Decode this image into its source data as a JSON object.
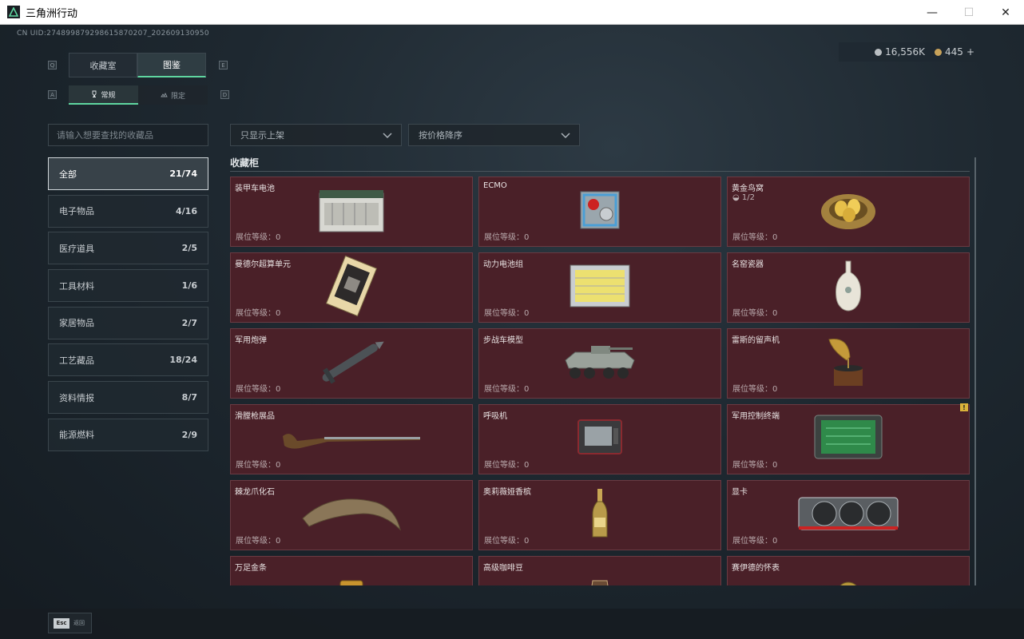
{
  "window": {
    "title": "三角洲行动",
    "minimize": "—",
    "maximize": "☐",
    "close": "✕"
  },
  "uid": "CN UID:274899879298615870207_202609130950",
  "currency": {
    "silver": "16,556K",
    "gold": "445",
    "plus": "+"
  },
  "keys": {
    "tab_left": "Q",
    "tab_right": "E",
    "sub_left": "A",
    "sub_right": "D"
  },
  "tabs": [
    {
      "label": "收藏室",
      "active": false
    },
    {
      "label": "图鉴",
      "active": true
    }
  ],
  "subtabs": [
    {
      "label": "常规",
      "active": true
    },
    {
      "label": "限定",
      "active": false
    }
  ],
  "search": {
    "placeholder": "请输入想要查找的收藏品"
  },
  "filters": {
    "shelf": "只显示上架",
    "sort": "按价格降序"
  },
  "categories": [
    {
      "label": "全部",
      "count": "21/74",
      "active": true
    },
    {
      "label": "电子物品",
      "count": "4/16"
    },
    {
      "label": "医疗道具",
      "count": "2/5"
    },
    {
      "label": "工具材料",
      "count": "1/6"
    },
    {
      "label": "家居物品",
      "count": "2/7"
    },
    {
      "label": "工艺藏品",
      "count": "18/24"
    },
    {
      "label": "资料情报",
      "count": "8/7"
    },
    {
      "label": "能源燃料",
      "count": "2/9"
    }
  ],
  "section_title": "收藏柜",
  "level_label": "展位等级：0",
  "items": [
    {
      "name": "装甲车电池",
      "icon": "battery"
    },
    {
      "name": "ECMO",
      "icon": "ecmo"
    },
    {
      "name": "黄金鸟窝",
      "icon": "nest",
      "sub": "1/2"
    },
    {
      "name": "曼德尔超算单元",
      "icon": "chip"
    },
    {
      "name": "动力电池组",
      "icon": "powerpack"
    },
    {
      "name": "名窑瓷器",
      "icon": "vase"
    },
    {
      "name": "军用炮弹",
      "icon": "missile"
    },
    {
      "name": "步战车模型",
      "icon": "ifv"
    },
    {
      "name": "雷斯的留声机",
      "icon": "gramophone"
    },
    {
      "name": "滑膛枪展品",
      "icon": "musket"
    },
    {
      "name": "呼吸机",
      "icon": "ventilator"
    },
    {
      "name": "军用控制终端",
      "icon": "terminal"
    },
    {
      "name": "棘龙爪化石",
      "icon": "claw"
    },
    {
      "name": "奥莉薇娅香槟",
      "icon": "champagne"
    },
    {
      "name": "显卡",
      "icon": "gpu"
    },
    {
      "name": "万足金条",
      "icon": "goldbar"
    },
    {
      "name": "高级咖啡豆",
      "icon": "coffee"
    },
    {
      "name": "赛伊德的怀表",
      "icon": "watch"
    }
  ],
  "warning": "!",
  "esc": {
    "key": "Esc",
    "label": "返回"
  }
}
